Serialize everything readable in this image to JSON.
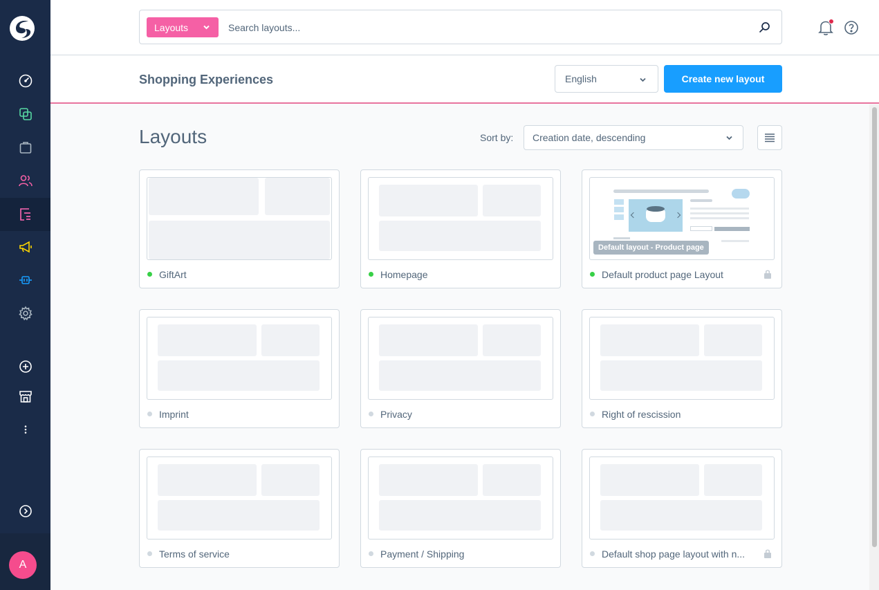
{
  "search": {
    "type_label": "Layouts",
    "placeholder": "Search layouts..."
  },
  "header": {
    "title": "Shopping Experiences",
    "language": "English",
    "create_label": "Create new layout"
  },
  "content": {
    "title": "Layouts",
    "sort_label": "Sort by:",
    "sort_value": "Creation date, descending"
  },
  "user": {
    "initial": "A"
  },
  "colors": {
    "active_dot": "#37d046",
    "inactive_dot": "#d1d9e0",
    "accent": "#189eff",
    "brand_pink": "#f560a5"
  },
  "layouts": [
    {
      "name": "GiftArt",
      "active": true,
      "locked": false
    },
    {
      "name": "Homepage",
      "active": true,
      "locked": false
    },
    {
      "name": "Default product page Layout",
      "active": true,
      "locked": true,
      "badge": "Default layout - Product page"
    },
    {
      "name": "Imprint",
      "active": false,
      "locked": false
    },
    {
      "name": "Privacy",
      "active": false,
      "locked": false
    },
    {
      "name": "Right of rescission",
      "active": false,
      "locked": false
    },
    {
      "name": "Terms of service",
      "active": false,
      "locked": false
    },
    {
      "name": "Payment / Shipping",
      "active": false,
      "locked": false
    },
    {
      "name": "Default shop page layout with n...",
      "active": false,
      "locked": true
    }
  ]
}
